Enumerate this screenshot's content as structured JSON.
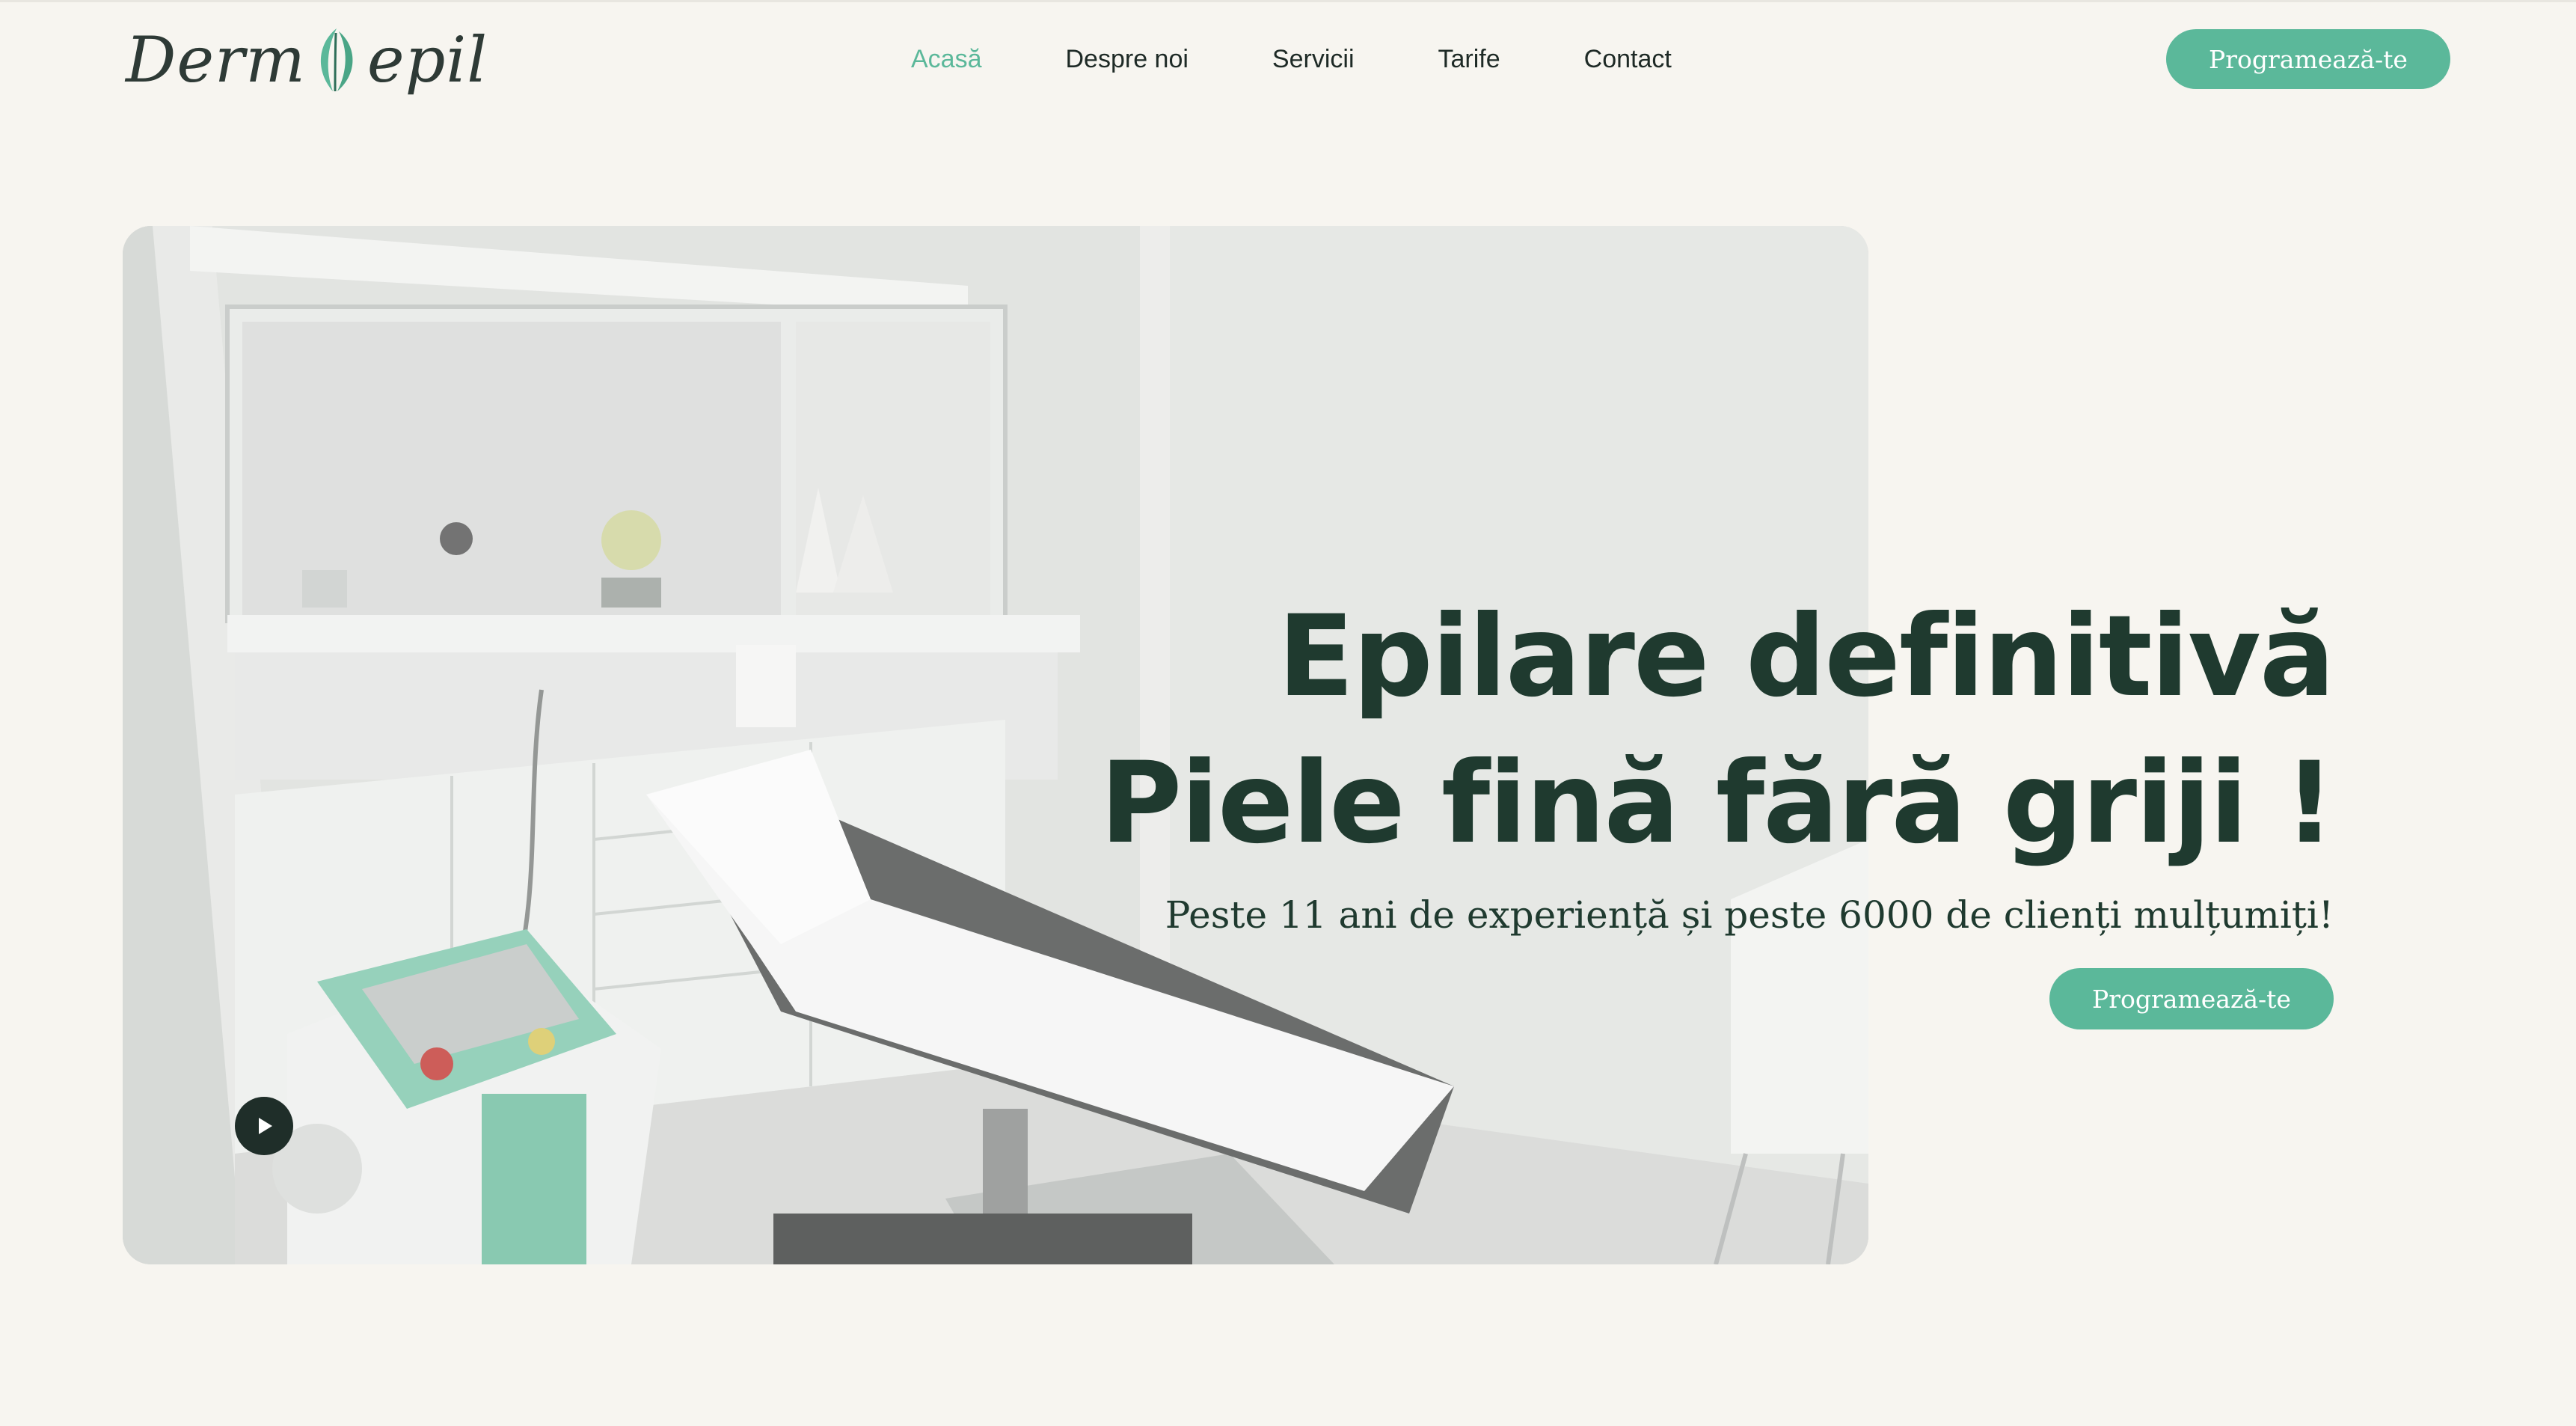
{
  "brand": {
    "logo_left": "Derm",
    "logo_right": "epil",
    "accent": "#5bb89a",
    "dark": "#1f3a2f"
  },
  "nav": {
    "items": [
      {
        "label": "Acasă",
        "active": true
      },
      {
        "label": "Despre noi"
      },
      {
        "label": "Servicii"
      },
      {
        "label": "Tarife"
      },
      {
        "label": "Contact"
      }
    ]
  },
  "header": {
    "cta_label": "Programează-te"
  },
  "hero": {
    "title_line1": "Epilare definitivă",
    "title_line2": "Piele fină fără griji !",
    "subtitle": "Peste 11 ani de experiență și peste 6000 de clienți mulțumiți!",
    "cta_label": "Programează-te",
    "play_icon": "play-icon"
  }
}
